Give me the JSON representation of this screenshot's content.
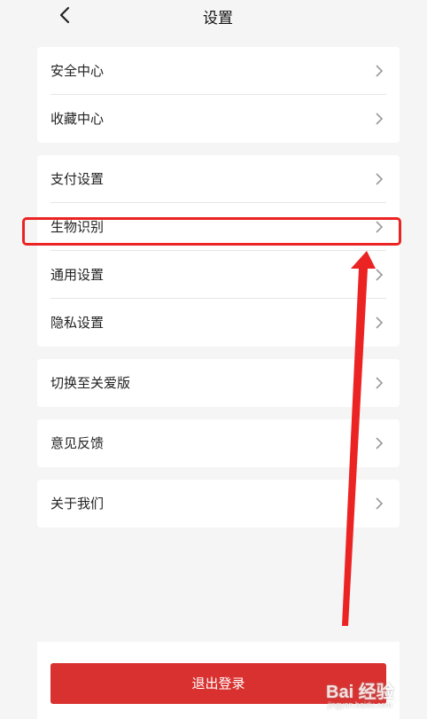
{
  "header": {
    "title": "设置",
    "back_icon": "chevron-left-icon"
  },
  "groups": [
    {
      "items": [
        {
          "label": "安全中心"
        },
        {
          "label": "收藏中心"
        }
      ]
    },
    {
      "items": [
        {
          "label": "支付设置"
        },
        {
          "label": "生物识别"
        },
        {
          "label": "通用设置"
        },
        {
          "label": "隐私设置"
        }
      ]
    },
    {
      "items": [
        {
          "label": "切换至关爱版"
        }
      ]
    },
    {
      "items": [
        {
          "label": "意见反馈"
        }
      ]
    },
    {
      "items": [
        {
          "label": "关于我们"
        }
      ]
    }
  ],
  "logout": {
    "label": "退出登录",
    "color": "#d8312f"
  },
  "annotation": {
    "highlight_color": "#ec2323"
  },
  "watermark": {
    "text": "Bai 经验",
    "sub": "jingyan.baidu.com"
  }
}
